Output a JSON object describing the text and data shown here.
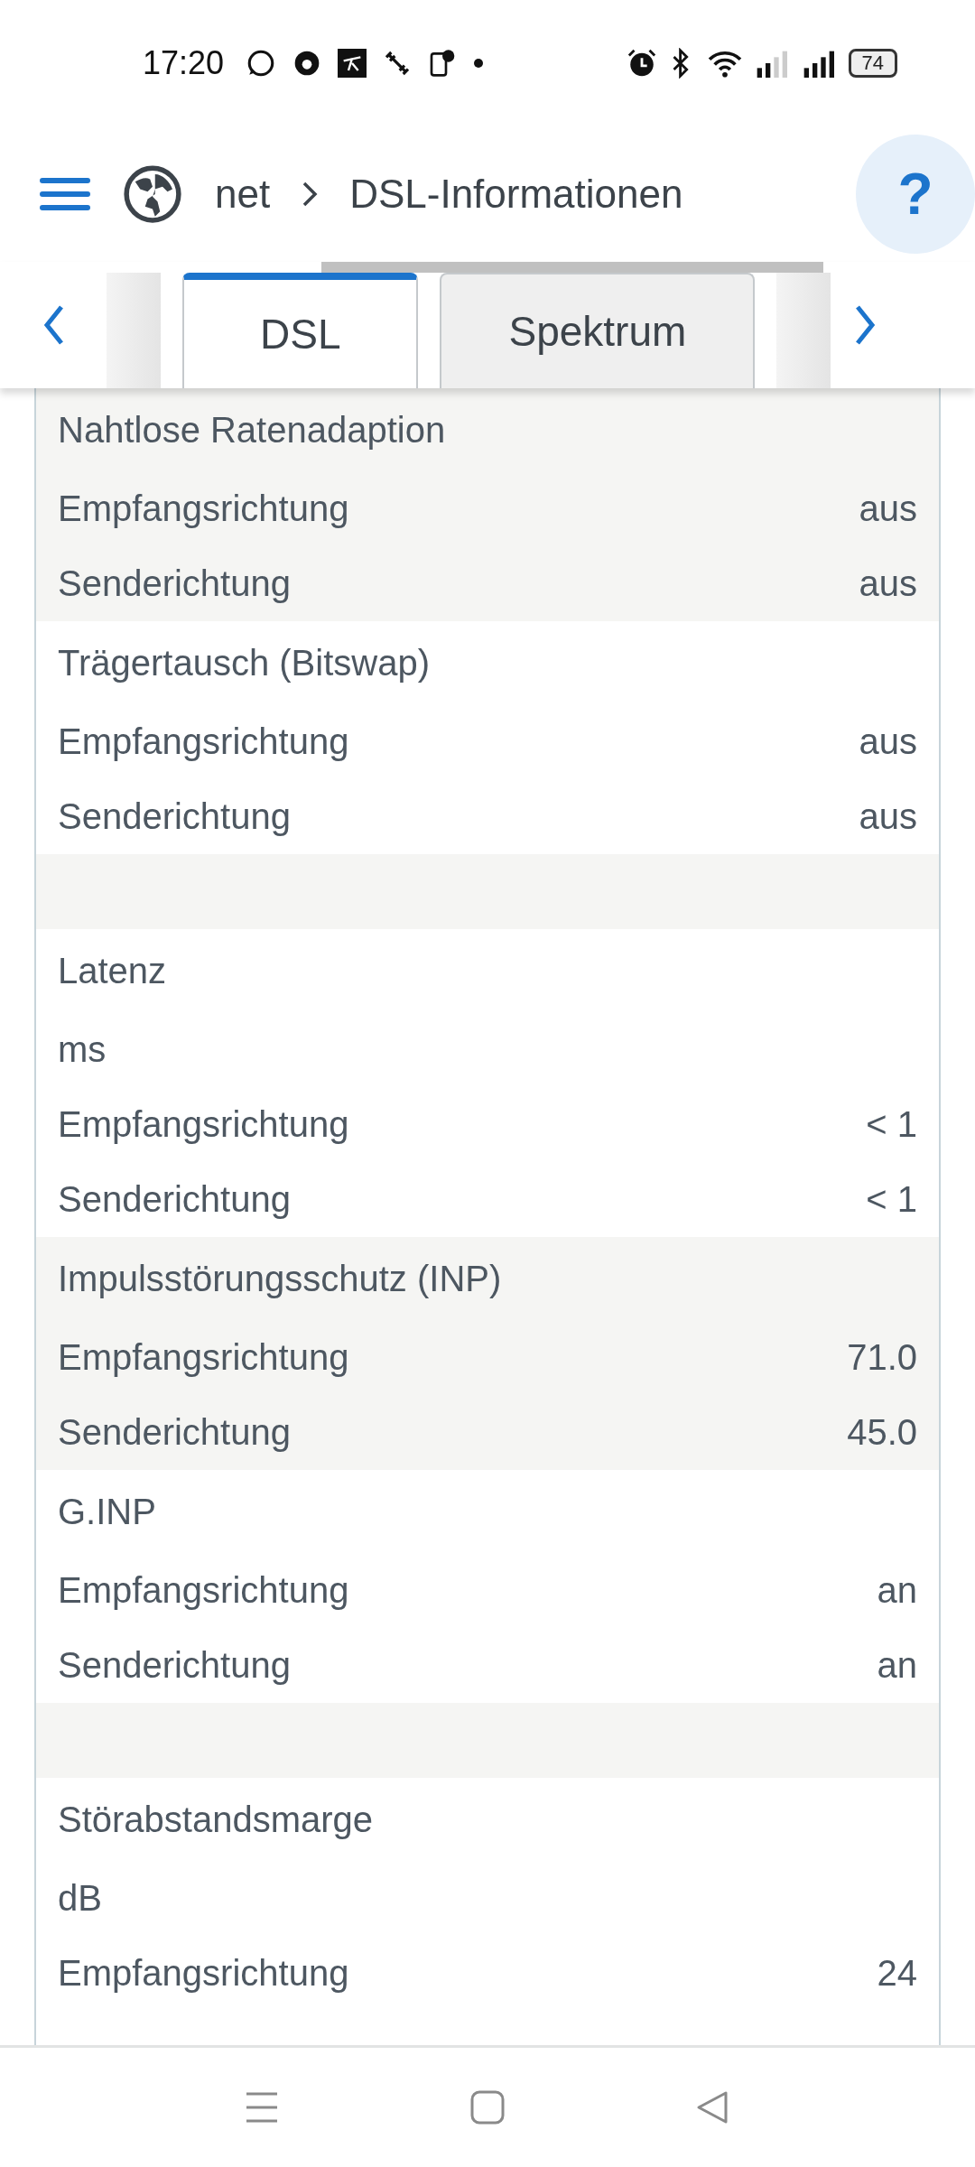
{
  "status_bar": {
    "time": "17:20",
    "battery": "74"
  },
  "header": {
    "breadcrumb": [
      "net",
      "DSL-Informationen"
    ],
    "help": "?"
  },
  "tabs": [
    {
      "label": "DSL",
      "selected": true
    },
    {
      "label": "Spektrum",
      "selected": false
    }
  ],
  "sections": [
    {
      "kind": "group",
      "shaded": true,
      "title": "Nahtlose Ratenadaption",
      "rows": [
        {
          "label": "Empfangsrichtung",
          "value": "aus"
        },
        {
          "label": "Senderichtung",
          "value": "aus"
        }
      ]
    },
    {
      "kind": "group",
      "shaded": false,
      "title": "Trägertausch (Bitswap)",
      "rows": [
        {
          "label": "Empfangsrichtung",
          "value": "aus"
        },
        {
          "label": "Senderichtung",
          "value": "aus"
        }
      ]
    },
    {
      "kind": "spacer",
      "shaded": true
    },
    {
      "kind": "group",
      "shaded": false,
      "title": "Latenz",
      "unit": "ms",
      "rows": [
        {
          "label": "Empfangsrichtung",
          "value": "< 1"
        },
        {
          "label": "Senderichtung",
          "value": "< 1"
        }
      ]
    },
    {
      "kind": "group",
      "shaded": true,
      "title": "Impulsstörungsschutz (INP)",
      "rows": [
        {
          "label": "Empfangsrichtung",
          "value": "71.0"
        },
        {
          "label": "Senderichtung",
          "value": "45.0"
        }
      ]
    },
    {
      "kind": "group",
      "shaded": false,
      "title": "G.INP",
      "rows": [
        {
          "label": "Empfangsrichtung",
          "value": "an"
        },
        {
          "label": "Senderichtung",
          "value": "an"
        }
      ]
    },
    {
      "kind": "spacer",
      "shaded": true
    },
    {
      "kind": "group",
      "shaded": false,
      "title": "Störabstandsmarge",
      "unit": "dB",
      "rows": [
        {
          "label": "Empfangsrichtung",
          "value": "24"
        }
      ]
    }
  ]
}
